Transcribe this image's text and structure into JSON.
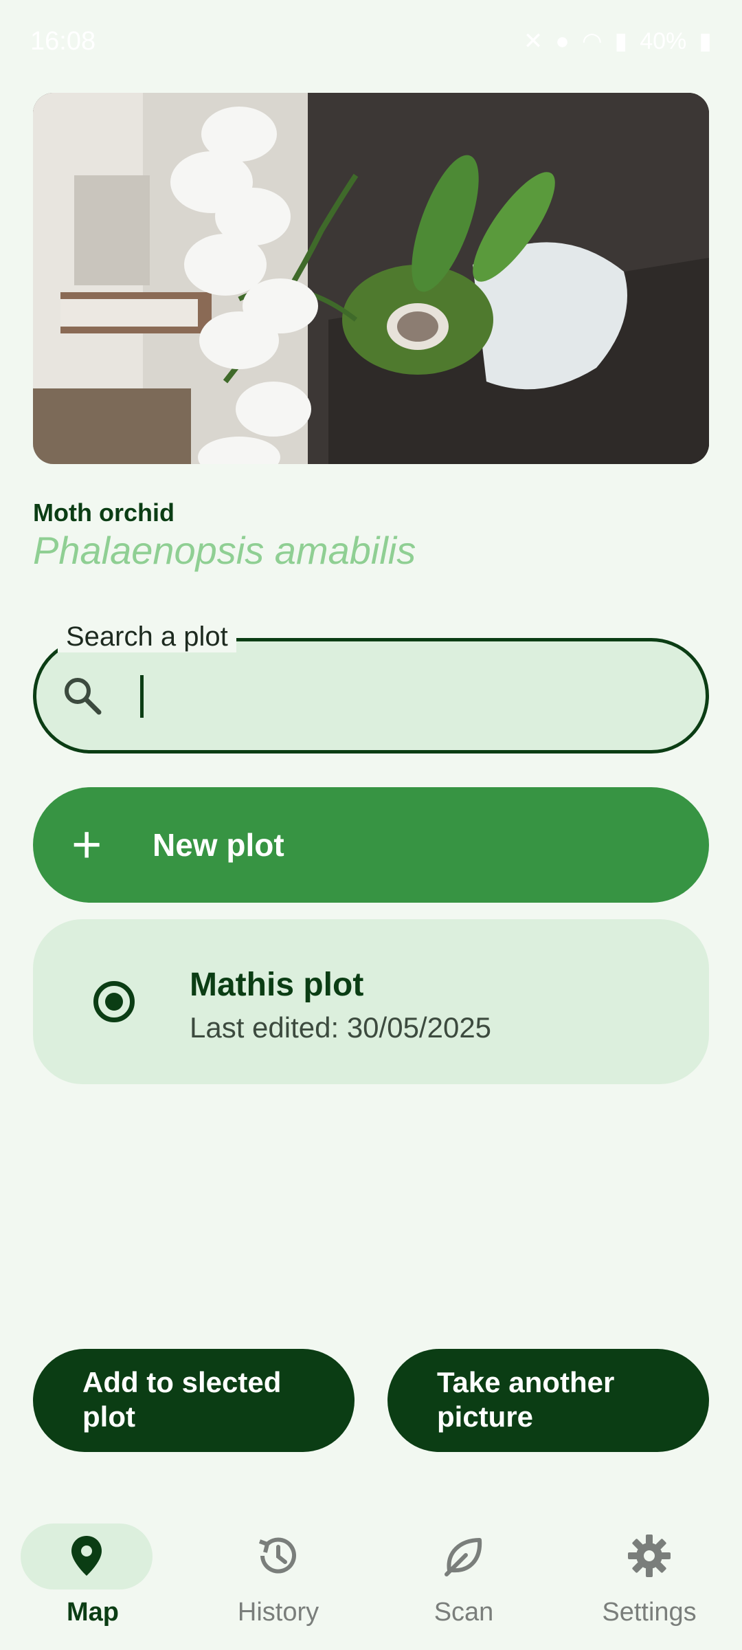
{
  "status_bar": {
    "time": "16:08",
    "battery": "40%"
  },
  "identification": {
    "common_name": "Moth orchid",
    "scientific_name": "Phalaenopsis amabilis"
  },
  "search": {
    "label": "Search a plot",
    "value": ""
  },
  "new_plot": {
    "label": "New plot"
  },
  "plots": [
    {
      "name": "Mathis plot",
      "last_edited": "Last edited: 30/05/2025",
      "selected": true
    }
  ],
  "actions": {
    "add_label": "Add to slected plot",
    "take_label": "Take another picture"
  },
  "nav": {
    "items": [
      {
        "label": "Map",
        "icon": "map-pin-icon",
        "active": true
      },
      {
        "label": "History",
        "icon": "history-icon",
        "active": false
      },
      {
        "label": "Scan",
        "icon": "leaf-icon",
        "active": false
      },
      {
        "label": "Settings",
        "icon": "gear-icon",
        "active": false
      }
    ]
  },
  "colors": {
    "background": "#f2f8f1",
    "dark_green": "#0b3d14",
    "primary_green": "#379443",
    "light_green": "#dcefdd",
    "scientific_name": "#8fcf93"
  }
}
